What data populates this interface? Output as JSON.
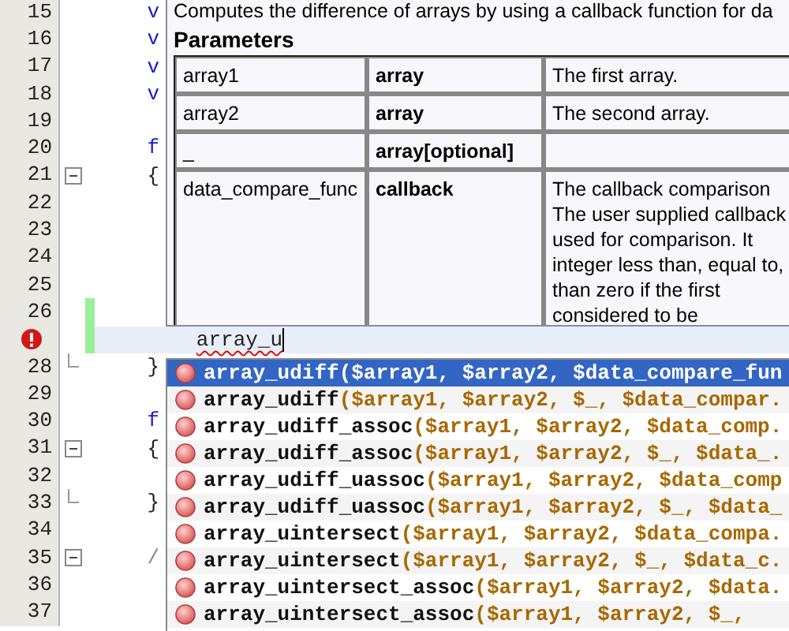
{
  "editor": {
    "lines": [
      {
        "number": "15",
        "code": "    v",
        "kind": "keyword",
        "collapsible": false,
        "block_end": false,
        "changed": false,
        "error": false,
        "current": false
      },
      {
        "number": "16",
        "code": "    v",
        "kind": "keyword",
        "collapsible": false,
        "block_end": false,
        "changed": false,
        "error": false,
        "current": false
      },
      {
        "number": "17",
        "code": "    v",
        "kind": "keyword",
        "collapsible": false,
        "block_end": false,
        "changed": false,
        "error": false,
        "current": false
      },
      {
        "number": "18",
        "code": "    v",
        "kind": "keyword",
        "collapsible": false,
        "block_end": false,
        "changed": false,
        "error": false,
        "current": false
      },
      {
        "number": "19",
        "collapsible": false,
        "block_end": false,
        "changed": false,
        "error": false,
        "current": false
      },
      {
        "number": "20",
        "code": "    f",
        "kind": "keyword",
        "collapsible": false,
        "block_end": false,
        "changed": false,
        "error": false,
        "current": false
      },
      {
        "number": "21",
        "code": "    {",
        "kind": "plain",
        "collapsible": true,
        "block_end": false,
        "changed": false,
        "error": false,
        "current": false
      },
      {
        "number": "22",
        "collapsible": false,
        "block_end": false,
        "changed": false,
        "error": false,
        "current": false
      },
      {
        "number": "23",
        "collapsible": false,
        "block_end": false,
        "changed": false,
        "error": false,
        "current": false
      },
      {
        "number": "24",
        "collapsible": false,
        "block_end": false,
        "changed": false,
        "error": false,
        "current": false
      },
      {
        "number": "25",
        "collapsible": false,
        "block_end": false,
        "changed": false,
        "error": false,
        "current": false
      },
      {
        "number": "26",
        "collapsible": false,
        "block_end": false,
        "changed": true,
        "error": false,
        "current": false
      },
      {
        "code": "        array_u",
        "kind": "plain",
        "collapsible": false,
        "block_end": false,
        "changed": true,
        "error": true,
        "current": true
      },
      {
        "number": "28",
        "code": "    }",
        "kind": "plain",
        "collapsible": false,
        "block_end": true,
        "changed": false,
        "error": false,
        "current": false
      },
      {
        "number": "29",
        "collapsible": false,
        "block_end": false,
        "changed": false,
        "error": false,
        "current": false
      },
      {
        "number": "30",
        "code": "    f",
        "kind": "keyword",
        "collapsible": false,
        "block_end": false,
        "changed": false,
        "error": false,
        "current": false
      },
      {
        "number": "31",
        "code": "    {",
        "kind": "plain",
        "collapsible": true,
        "block_end": false,
        "changed": false,
        "error": false,
        "current": false
      },
      {
        "number": "32",
        "collapsible": false,
        "block_end": false,
        "changed": false,
        "error": false,
        "current": false
      },
      {
        "number": "33",
        "code": "    }",
        "kind": "plain",
        "collapsible": false,
        "block_end": true,
        "changed": false,
        "error": false,
        "current": false
      },
      {
        "number": "34",
        "collapsible": false,
        "block_end": false,
        "changed": false,
        "error": false,
        "current": false
      },
      {
        "number": "35",
        "code": "    /",
        "kind": "comment",
        "collapsible": true,
        "block_end": false,
        "changed": false,
        "error": false,
        "current": false
      },
      {
        "number": "36",
        "collapsible": false,
        "block_end": false,
        "changed": false,
        "error": false,
        "current": false
      },
      {
        "number": "37",
        "collapsible": false,
        "block_end": false,
        "changed": false,
        "error": false,
        "current": false
      }
    ]
  },
  "documentation": {
    "summary": "Computes the difference of arrays by using a callback function for da",
    "parameters_heading": "Parameters",
    "parameters": [
      {
        "name": "array1",
        "type": "array",
        "description": [
          "The first array."
        ]
      },
      {
        "name": "array2",
        "type": "array",
        "description": [
          "The second array."
        ]
      },
      {
        "name": "_",
        "type": "array[optional]"
      },
      {
        "name": "data_compare_func",
        "type": "callback",
        "description": [
          "The callback comparison",
          "The user supplied callback",
          "used for comparison. It",
          "integer less than, equal to,",
          "than zero if the first",
          "considered to be"
        ]
      }
    ]
  },
  "completions": [
    {
      "name": "array_udiff",
      "params": "($array1, $array2, $data_compare_fun",
      "selected": true
    },
    {
      "name": "array_udiff",
      "params": "($array1, $array2, $_, $data_compar.",
      "selected": false
    },
    {
      "name": "array_udiff_assoc",
      "params": "($array1, $array2, $data_comp.",
      "selected": false
    },
    {
      "name": "array_udiff_assoc",
      "params": "($array1, $array2, $_, $data_.",
      "selected": false
    },
    {
      "name": "array_udiff_uassoc",
      "params": "($array1, $array2, $data_comp",
      "selected": false
    },
    {
      "name": "array_udiff_uassoc",
      "params": "($array1, $array2, $_, $data_",
      "selected": false
    },
    {
      "name": "array_uintersect",
      "params": "($array1, $array2, $data_compa.",
      "selected": false
    },
    {
      "name": "array_uintersect",
      "params": "($array1, $array2, $_, $data_c.",
      "selected": false
    },
    {
      "name": "array_uintersect_assoc",
      "params": "($array1, $array2, $data.",
      "selected": false
    },
    {
      "name": "array_uintersect_assoc",
      "params": "($array1, $array2, $_,",
      "selected": false
    }
  ]
}
